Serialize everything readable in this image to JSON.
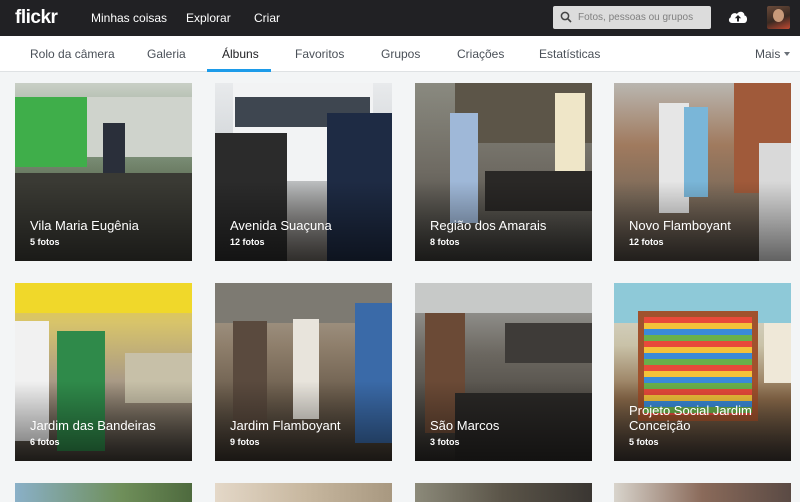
{
  "brand": {
    "logo": "flickr"
  },
  "topnav": {
    "items": [
      "Minhas coisas",
      "Explorar",
      "Criar"
    ],
    "search_placeholder": "Fotos, pessoas ou grupos"
  },
  "subnav": {
    "tabs": [
      "Rolo da câmera",
      "Galeria",
      "Álbuns",
      "Favoritos",
      "Grupos",
      "Criações",
      "Estatísticas"
    ],
    "active_tab": "Álbuns",
    "more": "Mais"
  },
  "albums": [
    {
      "title": "Vila Maria Eugênia",
      "count": "5 fotos"
    },
    {
      "title": "Avenida Suaçuna",
      "count": "12 fotos"
    },
    {
      "title": "Região dos Amarais",
      "count": "8 fotos"
    },
    {
      "title": "Novo Flamboyant",
      "count": "12 fotos"
    },
    {
      "title": "Jardim das Bandeiras",
      "count": "6 fotos"
    },
    {
      "title": "Jardim Flamboyant",
      "count": "9 fotos"
    },
    {
      "title": "São Marcos",
      "count": "3 fotos"
    },
    {
      "title": "Projeto Social Jardim Conceição",
      "count": "5 fotos"
    }
  ],
  "colors": {
    "topbar": "#212124",
    "accent": "#1c9be9",
    "page_bg": "#f3f5f6"
  }
}
